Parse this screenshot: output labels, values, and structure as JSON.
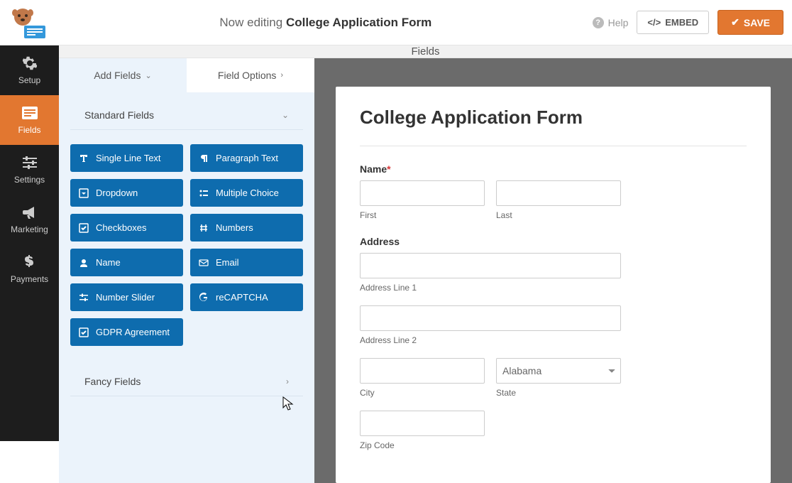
{
  "topbar": {
    "now_editing": "Now editing",
    "form_name": "College Application Form",
    "help": "Help",
    "embed": "EMBED",
    "save": "SAVE"
  },
  "sidenav": {
    "items": [
      {
        "label": "Setup"
      },
      {
        "label": "Fields"
      },
      {
        "label": "Settings"
      },
      {
        "label": "Marketing"
      },
      {
        "label": "Payments"
      }
    ]
  },
  "section_header": "Fields",
  "tabs": {
    "add_fields": "Add Fields",
    "field_options": "Field Options"
  },
  "groups": {
    "standard": "Standard Fields",
    "fancy": "Fancy Fields"
  },
  "fields": [
    {
      "label": "Single Line Text"
    },
    {
      "label": "Paragraph Text"
    },
    {
      "label": "Dropdown"
    },
    {
      "label": "Multiple Choice"
    },
    {
      "label": "Checkboxes"
    },
    {
      "label": "Numbers"
    },
    {
      "label": "Name"
    },
    {
      "label": "Email"
    },
    {
      "label": "Number Slider"
    },
    {
      "label": "reCAPTCHA"
    },
    {
      "label": "GDPR Agreement"
    }
  ],
  "preview": {
    "title": "College Application Form",
    "name_label": "Name",
    "first": "First",
    "last": "Last",
    "address_label": "Address",
    "addr1": "Address Line 1",
    "addr2": "Address Line 2",
    "city": "City",
    "state": "State",
    "state_value": "Alabama",
    "zip": "Zip Code"
  }
}
